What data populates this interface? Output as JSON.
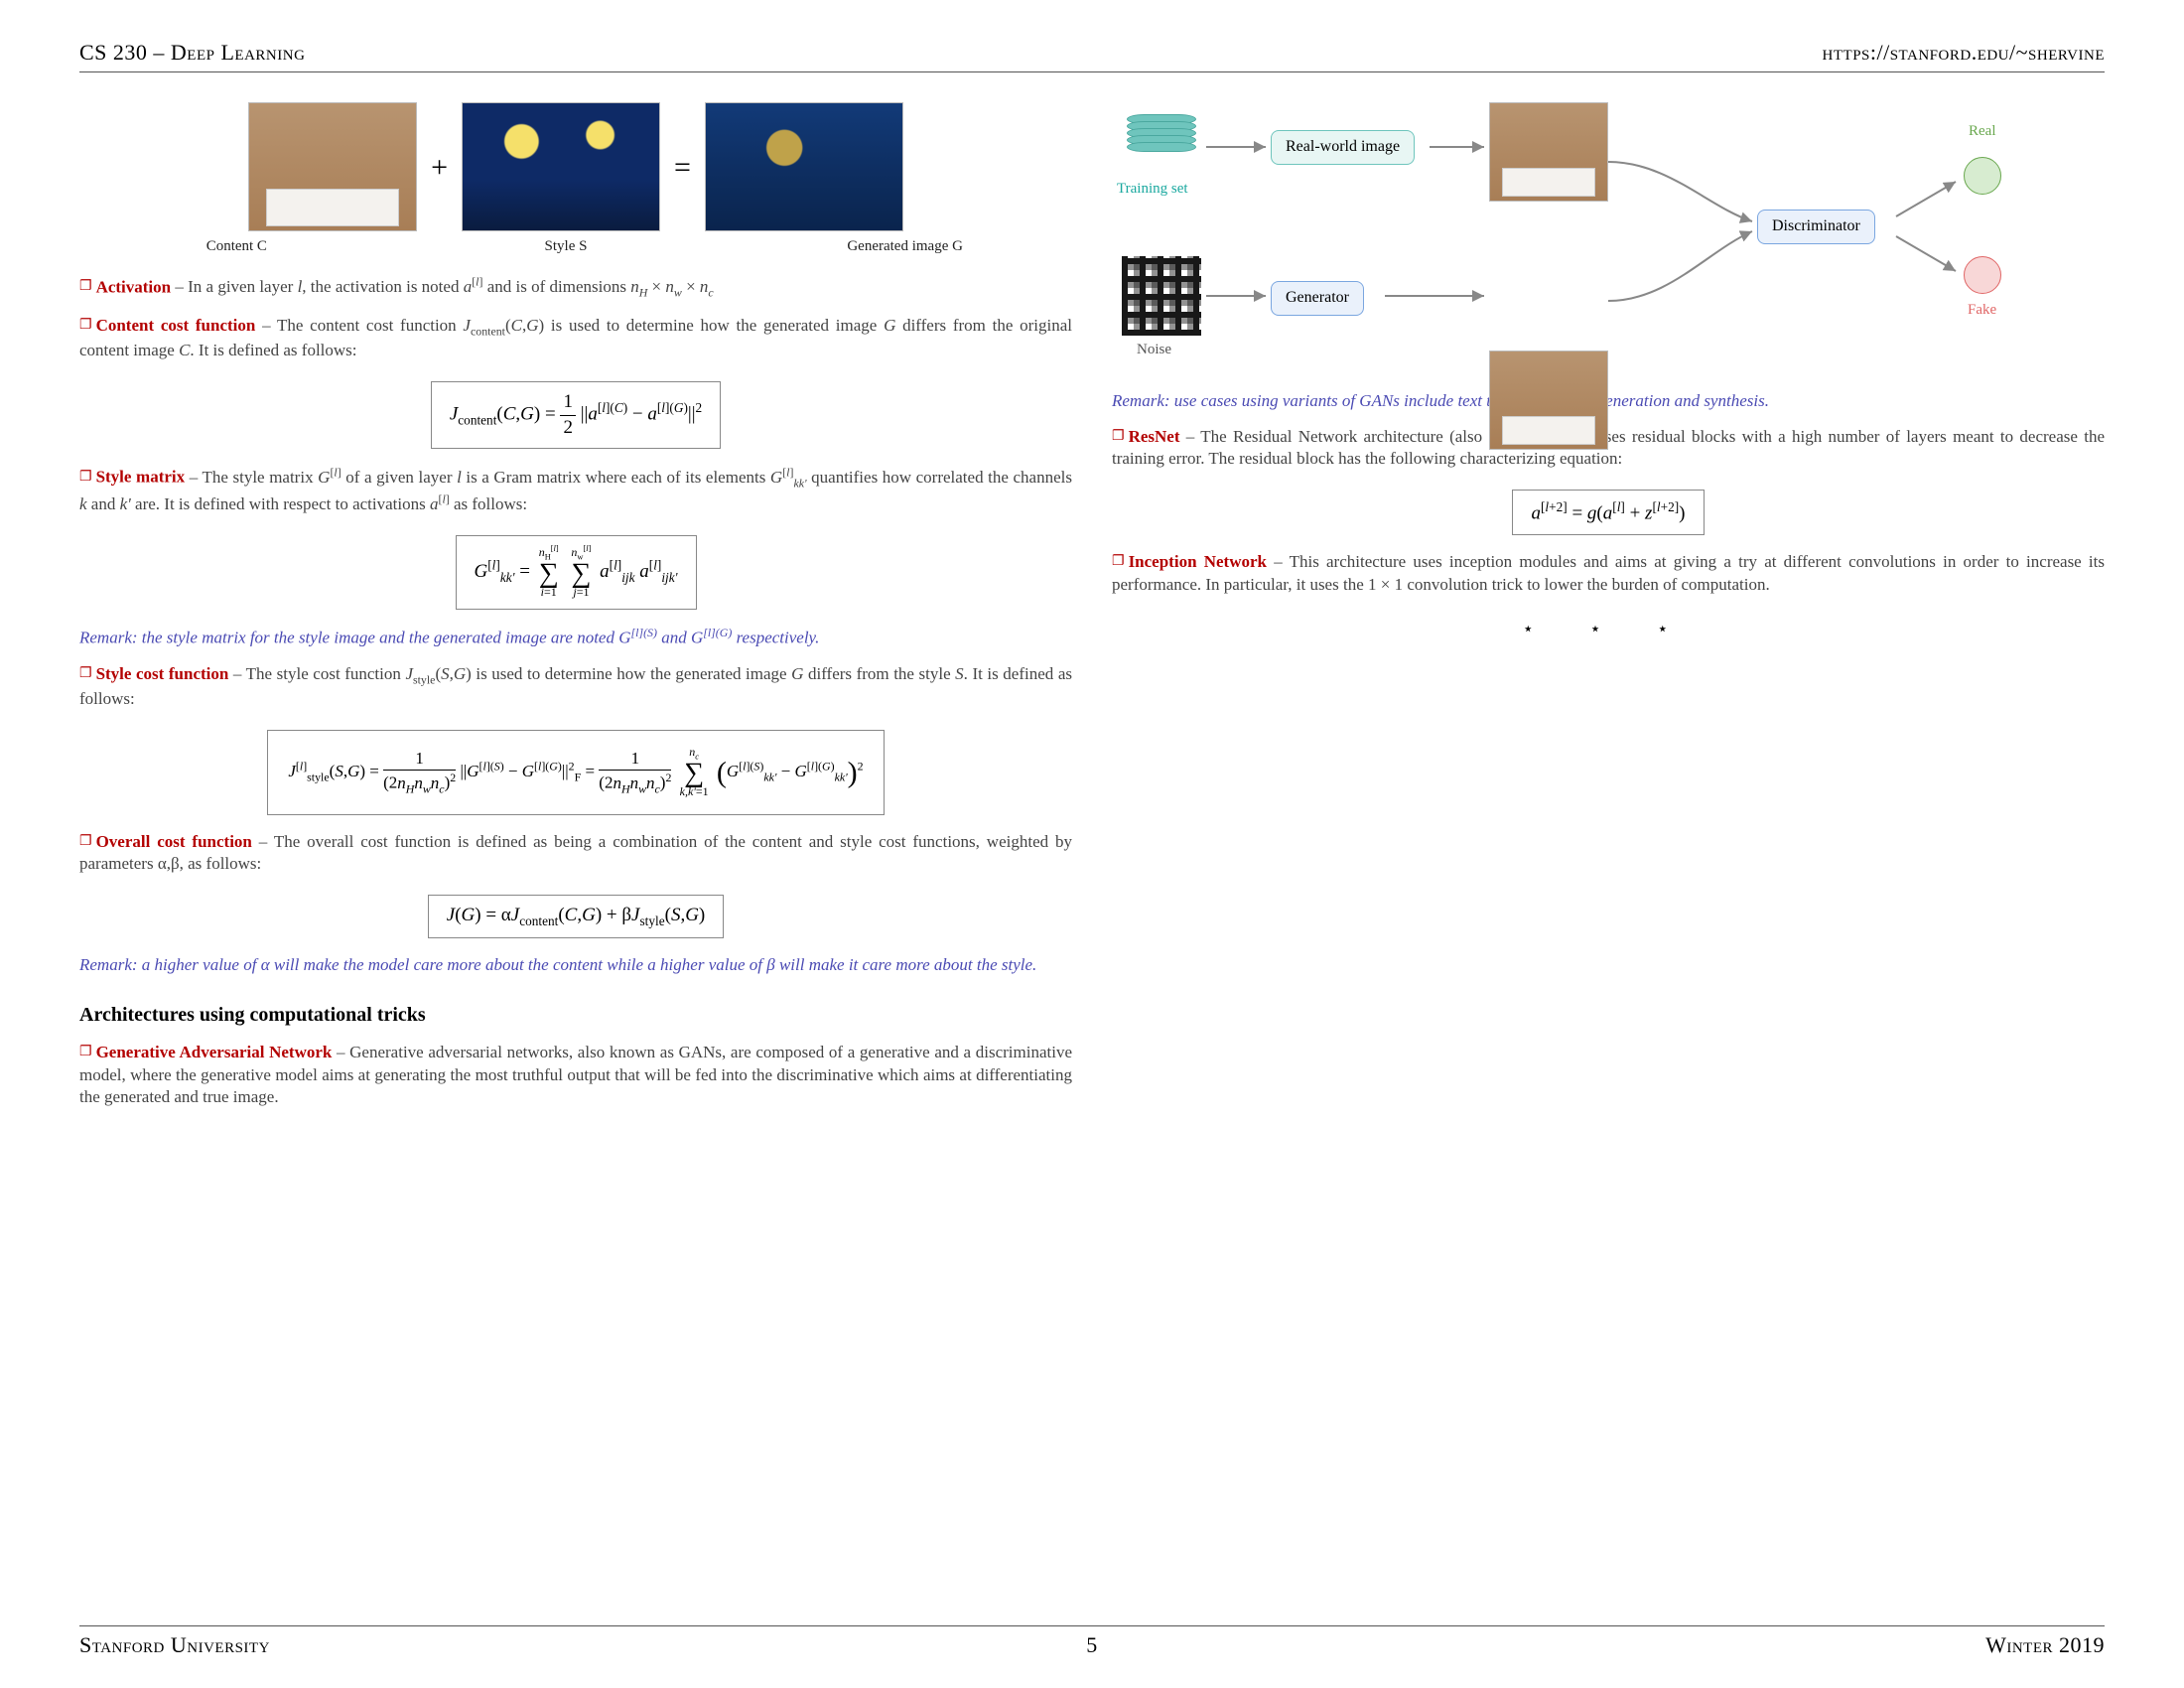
{
  "header": {
    "left": "CS 230 – Deep Learning",
    "right": "https://stanford.edu/~shervine"
  },
  "footer": {
    "left": "Stanford University",
    "page": "5",
    "right": "Winter 2019"
  },
  "styletransfer": {
    "caption_content": "Content C",
    "caption_style": "Style S",
    "caption_generated": "Generated image G",
    "plus": "+",
    "eq": "="
  },
  "defs": {
    "activation_head": "Activation",
    "activation_body": " – In a given layer l, the activation is noted a^[l] and is of dimensions n_H × n_w × n_c",
    "content_head": "Content cost function",
    "content_body": " – The content cost function J_content(C,G) is used to determine how the generated image G differs from the original content image C. It is defined as follows:",
    "content_formula": "J_content(C,G) = ½ || a^[l](C) − a^[l](G) ||²",
    "stylemat_head": "Style matrix",
    "stylemat_body": " – The style matrix G^[l] of a given layer l is a Gram matrix where each of its elements G^[l]_{kk'} quantifies how correlated the channels k and k' are. It is defined with respect to activations a^[l] as follows:",
    "stylemat_formula": "G^[l]_{kk'} = Σ_{i=1}^{n_H^[l]} Σ_{j=1}^{n_w^[l]} a^[l]_{ijk} a^[l]_{ijk'}",
    "stylemat_remark": "Remark: the style matrix for the style image and the generated image are noted G^[l](S) and G^[l](G) respectively.",
    "stylecost_head": "Style cost function",
    "stylecost_body": " – The style cost function J_style(S,G) is used to determine how the generated image G differs from the style S. It is defined as follows:",
    "stylecost_formula": "J^[l]_style(S,G) = 1/(2 n_H n_w n_c)² · || G^[l](S) − G^[l](G) ||²_F = 1/(2 n_H n_w n_c)² · Σ_{k,k'=1}^{n_c} ( G^[l](S)_{kk'} − G^[l](G)_{kk'} )²",
    "overall_head": "Overall cost function",
    "overall_body": " – The overall cost function is defined as being a combination of the content and style cost functions, weighted by parameters α,β, as follows:",
    "overall_formula": "J(G) = α J_content(C,G) + β J_style(S,G)",
    "overall_remark": "Remark: a higher value of α will make the model care more about the content while a higher value of β will make it care more about the style."
  },
  "section_arch": "Architectures using computational tricks",
  "gan": {
    "head": "Generative Adversarial Network",
    "body": " – Generative adversarial networks, also known as GANs, are composed of a generative and a discriminative model, where the generative model aims at generating the most truthful output that will be fed into the discriminative which aims at differentiating the generated and true image.",
    "training_set": "Training set",
    "realworld": "Real-world image",
    "generator": "Generator",
    "discriminator": "Discriminator",
    "noise": "Noise",
    "real": "Real",
    "fake": "Fake",
    "remark": "Remark: use cases using variants of GANs include text to image, music generation and synthesis."
  },
  "resnet": {
    "head": "ResNet",
    "body": " – The Residual Network architecture (also called ResNet) uses residual blocks with a high number of layers meant to decrease the training error. The residual block has the following characterizing equation:",
    "formula": "a^[l+2] = g(a^[l] + z^[l+2])"
  },
  "inception": {
    "head": "Inception Network",
    "body": " – This architecture uses inception modules and aims at giving a try at different convolutions in order to increase its performance. In particular, it uses the 1 × 1 convolution trick to lower the burden of computation."
  },
  "stars": "⋆   ⋆   ⋆"
}
